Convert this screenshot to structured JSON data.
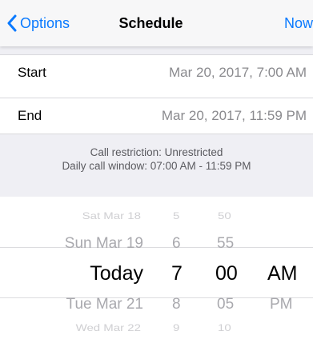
{
  "nav": {
    "back_label": "Options",
    "title": "Schedule",
    "right_label": "Now",
    "accent": "#0a7aff"
  },
  "schedule": {
    "start_label": "Start",
    "start_value": "Mar 20, 2017, 7:00 AM",
    "end_label": "End",
    "end_value": "Mar 20, 2017, 11:59 PM"
  },
  "info": {
    "restriction": "Call restriction: Unrestricted",
    "window": "Daily call window: 07:00 AM - 11:59 PM"
  },
  "picker": {
    "days": [
      "Sat Mar 18",
      "Sun Mar 19",
      "Today",
      "Tue Mar 21",
      "Wed Mar 22"
    ],
    "hours": [
      "5",
      "6",
      "7",
      "8",
      "9"
    ],
    "minutes": [
      "50",
      "55",
      "00",
      "05",
      "10"
    ],
    "ampm": [
      "AM",
      "PM"
    ],
    "selected": {
      "day": "Today",
      "hour": "7",
      "minute": "00",
      "ampm": "AM"
    }
  }
}
